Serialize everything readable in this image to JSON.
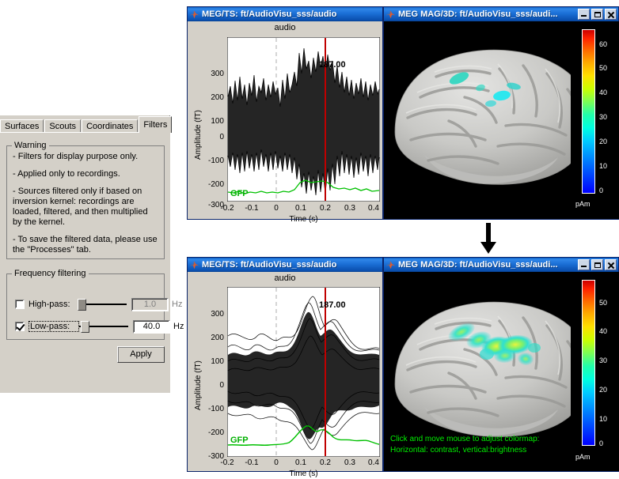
{
  "filters_panel": {
    "tabs": [
      {
        "label": "Surfaces",
        "active": false
      },
      {
        "label": "Scouts",
        "active": false
      },
      {
        "label": "Coordinates",
        "active": false
      },
      {
        "label": "Filters",
        "active": true
      }
    ],
    "warning_group": {
      "legend": "Warning",
      "lines": [
        "- Filters for display purpose only.",
        "- Applied only to recordings.",
        "- Sources filtered only if based on inversion kernel: recordings are loaded, filtered, and then multiplied by the kernel.",
        "- To save the filtered data, please use the \"Processes\" tab."
      ]
    },
    "frequency_group": {
      "legend": "Frequency filtering",
      "highpass": {
        "label": "High-pass:",
        "checked": false,
        "value": "1.0",
        "unit": "Hz",
        "slider_pct": 0
      },
      "lowpass": {
        "label": "Low-pass:",
        "checked": true,
        "value": "40.0",
        "unit": "Hz",
        "slider_pct": 4
      }
    },
    "apply_button": "Apply"
  },
  "windows": {
    "ts_top": {
      "title": "MEG/TS: ft/AudioVisu_sss/audio",
      "icon": "matlab-icon",
      "buttons": []
    },
    "brain_top": {
      "title": "MEG MAG/3D: ft/AudioVisu_sss/audi...",
      "icon": "matlab-icon",
      "buttons": [
        "minimize",
        "maximize",
        "close"
      ]
    },
    "ts_bottom": {
      "title": "MEG/TS: ft/AudioVisu_sss/audio",
      "icon": "matlab-icon",
      "buttons": []
    },
    "brain_bottom": {
      "title": "MEG MAG/3D: ft/AudioVisu_sss/audi...",
      "icon": "matlab-icon",
      "buttons": [
        "minimize",
        "maximize",
        "close"
      ]
    }
  },
  "chart_data": [
    {
      "id": "timeseries-unfiltered",
      "type": "line",
      "title": "audio",
      "xlabel": "Time (s)",
      "ylabel": "Amplitude (fT)",
      "xlim": [
        -0.2,
        0.42
      ],
      "ylim": [
        -360,
        360
      ],
      "xticks": [
        -0.2,
        -0.1,
        0,
        0.1,
        0.2,
        0.3,
        0.4
      ],
      "xticklabels": [
        "-0.2",
        "-0.1",
        "0",
        "0.1",
        "0.2",
        "0.3",
        "0.4"
      ],
      "yticks": [
        -300,
        -200,
        -100,
        0,
        100,
        200,
        300
      ],
      "yticklabels": [
        "-300",
        "-200",
        "-100",
        "0",
        "100",
        "200",
        "300"
      ],
      "grid": false,
      "annotations": [
        {
          "text": "187.00",
          "x": 0.13,
          "y": 345,
          "color": "#000000"
        },
        {
          "text": "GFP",
          "x": -0.165,
          "y": -300,
          "color": "#00b000"
        }
      ],
      "markers": [
        {
          "name": "zero-line",
          "x": 0.0,
          "style": "dashed",
          "color": "#b0b0b0"
        },
        {
          "name": "cursor-line",
          "x": 0.187,
          "style": "solid",
          "color": "#cc0000"
        },
        {
          "name": "baseline",
          "y": 0,
          "style": "solid",
          "color": "#b0b0b0"
        }
      ],
      "series": [
        {
          "name": "MEG MAG traces",
          "color": "#202020",
          "description": "raw unfiltered broadband multi-channel butterfly plot, noisy envelope +/-150 fT baseline, peak ~330 fT at 0.11 s and trough ~-300 fT at 0.12 s"
        },
        {
          "name": "GFP",
          "color": "#00c000",
          "description": "global field power trace near -335 fT baseline, rising to -310 fT around 0.11-0.17 s"
        }
      ]
    },
    {
      "id": "timeseries-lowpass-40hz",
      "type": "line",
      "title": "audio",
      "xlabel": "Time (s)",
      "ylabel": "Amplitude (fT)",
      "xlim": [
        -0.2,
        0.42
      ],
      "ylim": [
        -340,
        340
      ],
      "xticks": [
        -0.2,
        -0.1,
        0,
        0.1,
        0.2,
        0.3,
        0.4
      ],
      "xticklabels": [
        "-0.2",
        "-0.1",
        "0",
        "0.1",
        "0.2",
        "0.3",
        "0.4"
      ],
      "yticks": [
        -300,
        -200,
        -100,
        0,
        100,
        200,
        300
      ],
      "yticklabels": [
        "-300",
        "-200",
        "-100",
        "0",
        "100",
        "200",
        "300"
      ],
      "grid": false,
      "annotations": [
        {
          "text": "187.00",
          "x": 0.13,
          "y": 320,
          "color": "#000000"
        },
        {
          "text": "GFP",
          "x": -0.165,
          "y": -265,
          "color": "#00b000"
        }
      ],
      "markers": [
        {
          "name": "zero-line",
          "x": 0.0,
          "style": "dashed",
          "color": "#b0b0b0"
        },
        {
          "name": "cursor-line",
          "x": 0.187,
          "style": "solid",
          "color": "#cc0000"
        },
        {
          "name": "baseline",
          "y": 0,
          "style": "solid",
          "color": "#b0b0b0"
        }
      ],
      "series": [
        {
          "name": "MEG MAG traces",
          "color": "#202020",
          "description": "40 Hz low-pass filtered butterfly plot, smooth envelope +/-110 fT baseline, peak ~290 fT at 0.11 s and trough ~-240 fT at 0.12 s"
        },
        {
          "name": "GFP",
          "color": "#00c000",
          "description": "smoothed global field power near -295 fT baseline rising to -255 fT around 0.11-0.18 s"
        }
      ]
    }
  ],
  "brain_top": {
    "colorbar": {
      "unit": "pAm",
      "ticks": [
        "60",
        "50",
        "40",
        "30",
        "20",
        "10",
        "0"
      ],
      "min": 0,
      "max": 68,
      "colormap": "jet"
    },
    "activation_note": "small cyan activation patches near superior parietal / central sulcus"
  },
  "brain_bottom": {
    "colorbar": {
      "unit": "pAm",
      "ticks": [
        "50",
        "40",
        "30",
        "20",
        "10",
        "0"
      ],
      "min": 0,
      "max": 57,
      "colormap": "jet"
    },
    "overlay_lines": [
      "Click and move mouse to adjust colormap:",
      "Horizontal: contrast, vertical:brightness"
    ],
    "activation_note": "larger cyan-green-yellow activation cluster over central / superior parietal region"
  },
  "flow": {
    "arrow": "down-arrow"
  },
  "colors": {
    "panel_face": "#d4d0c8",
    "title_blue": "#0a4fae",
    "gfp_green": "#00b000",
    "cursor_red": "#cc0000",
    "overlay_green": "#00ee00"
  }
}
